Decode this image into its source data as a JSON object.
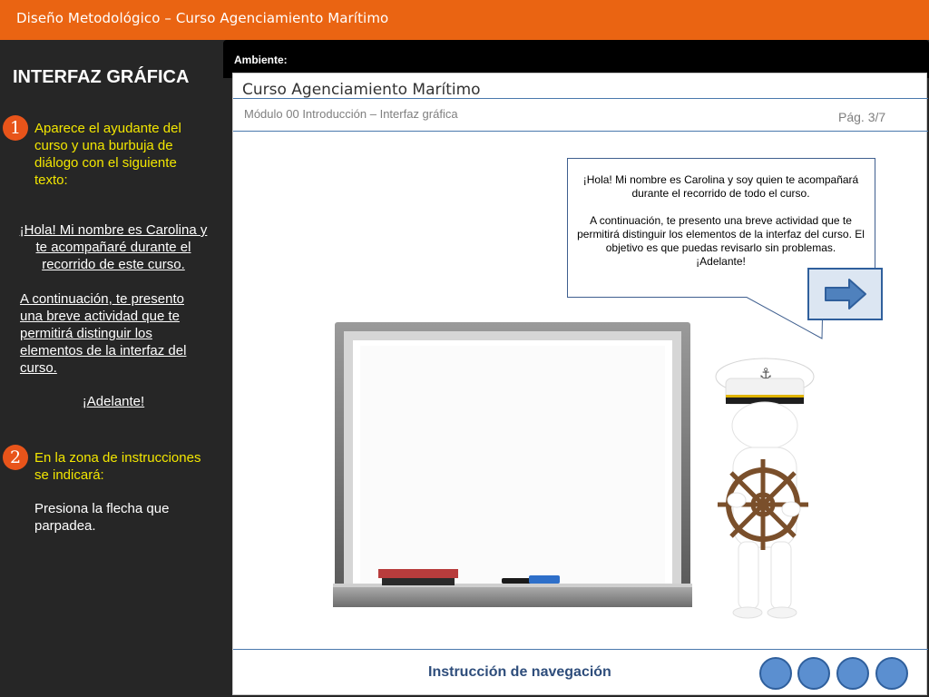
{
  "header": {
    "title": "Diseño  Metodológico – Curso Agenciamiento Marítimo"
  },
  "left_panel": {
    "heading": "INTERFAZ GRÁFICA",
    "steps": [
      {
        "number": "1",
        "text": "Aparece el ayudante del curso y una burbuja de diálogo con el siguiente texto:"
      },
      {
        "number": "2",
        "text": "En la zona de instrucciones se indicará:",
        "action": "Presiona la flecha que parpadea."
      }
    ],
    "dialog": {
      "greeting": "¡Hola! Mi nombre es Carolina y te acompañaré durante el recorrido de este curso.",
      "continuation": "A continuación, te presento una breve actividad que te permitirá distinguir los elementos de la interfaz del curso.",
      "closing": "¡Adelante!"
    }
  },
  "environment": {
    "label": "Ambiente:"
  },
  "slide": {
    "course_title": "Curso Agenciamiento Marítimo",
    "module_subtitle": "Módulo 00 Introducción – Interfaz gráfica",
    "page_indicator": "Pág. 3/7",
    "speech_bubble": {
      "paragraph1": "¡Hola! Mi nombre es Carolina y soy quien te acompañará durante el recorrido de todo el curso.",
      "paragraph2": "A continuación, te presento una breve actividad que te permitirá distinguir los elementos de la interfaz del curso. El objetivo es que puedas revisarlo sin problemas.",
      "closing": "¡Adelante!"
    },
    "next_button_icon": "right-arrow-icon",
    "footer": {
      "nav_instruction": "Instrucción de navegación",
      "nav_dots": 4
    }
  },
  "colors": {
    "topbar": "#ea6412",
    "panel_bg": "#262626",
    "step_text": "#f2e600",
    "step_badge": "#e8541a",
    "accent_blue": "#4a79ad",
    "nav_dot": "#5b8fd0"
  }
}
